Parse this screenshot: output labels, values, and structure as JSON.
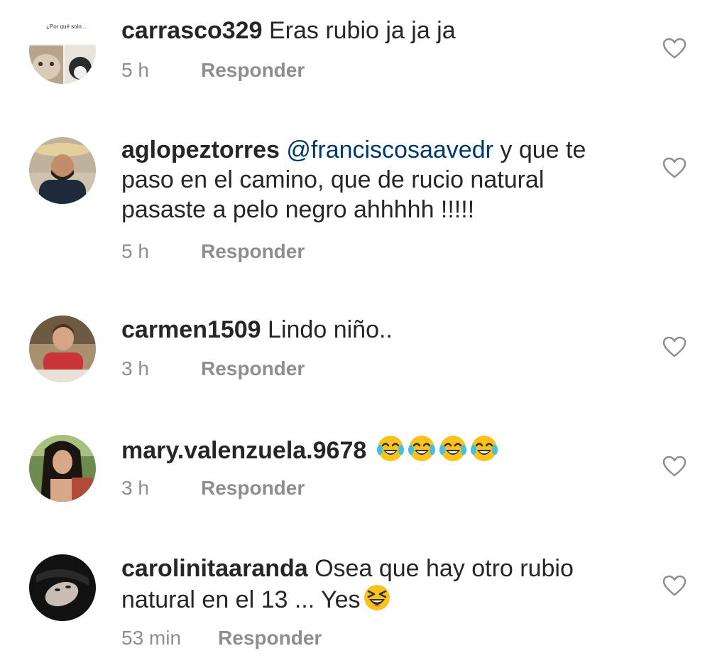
{
  "comments": [
    {
      "username": "carrasco329",
      "text": " Eras rubio ja ja ja",
      "time": "5 h",
      "reply_label": "Responder",
      "avatar_caption": "¿Por qué solo... fotos de tu cara?"
    },
    {
      "username": "aglopeztorres",
      "mention": "@franciscosaavedr",
      "text": " y que te paso en el camino, que de rucio natural pasaste a pelo negro ahhhhh !!!!!",
      "time": "5 h",
      "reply_label": "Responder"
    },
    {
      "username": "carmen1509",
      "text": " Lindo niño..",
      "time": "3 h",
      "reply_label": "Responder"
    },
    {
      "username": "mary.valenzuela.9678",
      "text": " ",
      "emojis": [
        "tears-of-joy-emoji",
        "tears-of-joy-emoji",
        "tears-of-joy-emoji",
        "tears-of-joy-emoji"
      ],
      "time": "3 h",
      "reply_label": "Responder"
    },
    {
      "username": "carolinitaaranda",
      "text": " Osea que hay otro rubio natural en el 13 ... Yes",
      "emojis": [
        "squinting-laugh-emoji"
      ],
      "time": "53 min",
      "reply_label": "Responder"
    }
  ],
  "colors": {
    "text": "#262626",
    "meta": "#8e8e8e",
    "mention": "#00376b",
    "heart_outline": "#8e8e8e"
  },
  "icons": {
    "like": "heart-outline-icon"
  }
}
